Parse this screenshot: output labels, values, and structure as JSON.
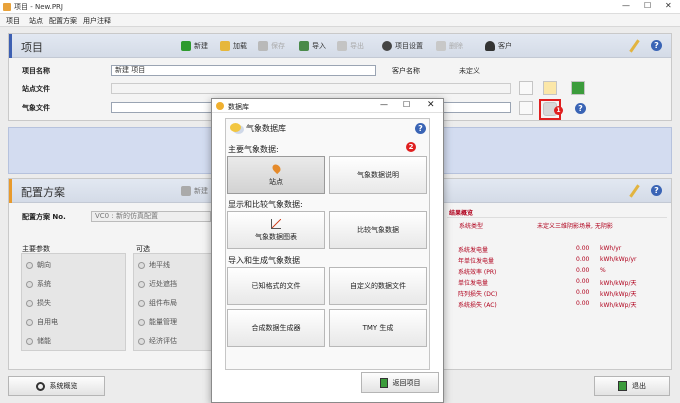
{
  "window": {
    "title": "项目 - New.PRJ"
  },
  "menu": [
    "项目",
    "站点",
    "配置方案",
    "用户注释"
  ],
  "project": {
    "section_title": "项目",
    "toolbar": {
      "new": "新建",
      "load": "加载",
      "save": "保存",
      "import": "导入",
      "export": "导出",
      "settings": "项目设置",
      "delete": "删除",
      "client": "客户"
    },
    "name_label": "项目名称",
    "name_value": "新建 项目",
    "client_label": "客户名称",
    "client_value": "未定义",
    "site_label": "站点文件",
    "meteo_label": "气象文件",
    "annotation": "1"
  },
  "config": {
    "section_title": "配置方案",
    "new_label": "新建",
    "label": "配置方案 No.",
    "value": "VC0   : 新的仿真配置",
    "main_params": {
      "title": "主要参数",
      "items": [
        "朝向",
        "系统",
        "损失",
        "自用电",
        "储能"
      ]
    },
    "optional": {
      "title": "可选",
      "items": [
        "地平线",
        "近处遮挡",
        "组件布局",
        "能量管理",
        "经济评估"
      ]
    },
    "results": {
      "title": "结果概览",
      "type_label": "系统类型",
      "type_value": "未定义三维阴影场景, 无阴影",
      "rows": [
        {
          "label": "系统发电量",
          "value": "0.00",
          "unit": "kWh/yr"
        },
        {
          "label": "年单位发电量",
          "value": "0.00",
          "unit": "kWh/kWp/yr"
        },
        {
          "label": "系统效率 (PR)",
          "value": "0.00",
          "unit": "%"
        },
        {
          "label": "单位发电量",
          "value": "0.00",
          "unit": "kWh/kWp/天"
        },
        {
          "label": "阵列损失 (DC)",
          "value": "0.00",
          "unit": "kWh/kWp/天"
        },
        {
          "label": "系统损失 (AC)",
          "value": "0.00",
          "unit": "kWh/kWp/天"
        }
      ]
    }
  },
  "bottom": {
    "overview": "系统概览",
    "exit": "退出"
  },
  "dialog": {
    "title": "数据库",
    "header": "气象数据库",
    "annotation": "2",
    "group1": {
      "title": "主要气象数据:",
      "btn1": "站点",
      "btn2": "气象数据说明"
    },
    "group2": {
      "title": "显示和比较气象数据:",
      "btn1": "气象数据图表",
      "btn2": "比较气象数据"
    },
    "group3": {
      "title": "导入和生成气象数据",
      "btn1": "已知格式的文件",
      "btn2": "自定义的数据文件",
      "btn3": "合成数据生成器",
      "btn4": "TMY 生成"
    },
    "back": "返回项目"
  },
  "colors": {
    "accent_blue": "#3d5fb2",
    "accent_orange": "#e89a2c",
    "annotation_red": "#e02020",
    "result_red": "#b0001c"
  }
}
